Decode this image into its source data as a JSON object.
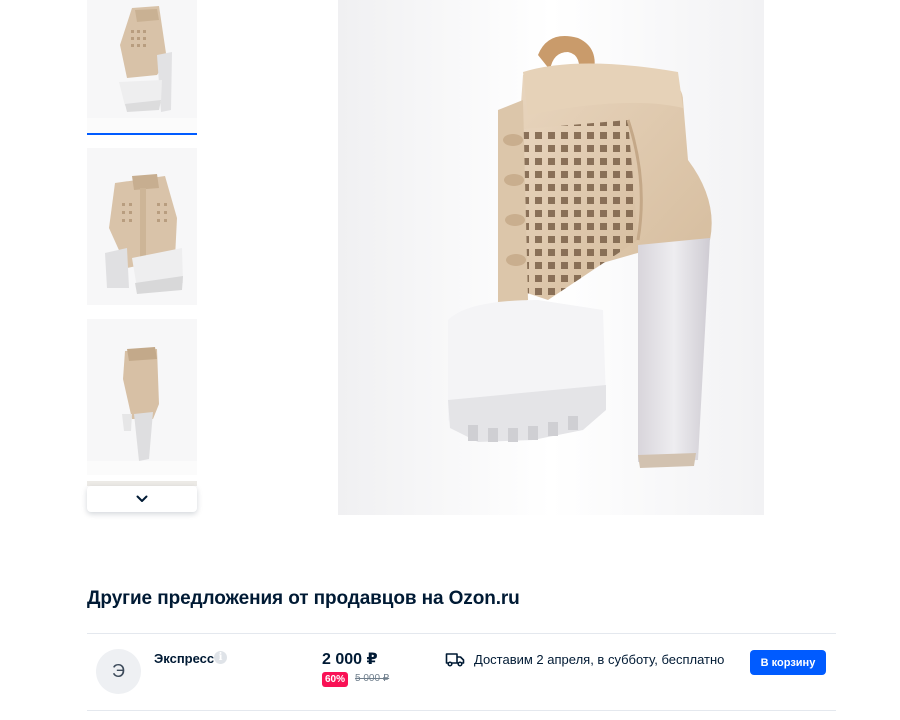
{
  "gallery": {
    "more_icon": "chevron-down-icon",
    "thumbnail_active_color": "#005bff"
  },
  "offers": {
    "title": "Другие предложения от продавцов на Ozon.ru",
    "items": [
      {
        "seller_initial": "Э",
        "seller_name": "Экспресс",
        "info_icon": "i",
        "price": "2 000 ₽",
        "discount": "60%",
        "old_price": "5 000 ₽",
        "delivery_icon": "truck-icon",
        "delivery_text": "Доставим 2 апреля, в субботу, бесплатно",
        "cart_button_label": "В корзину"
      }
    ]
  },
  "colors": {
    "accent": "#005bff",
    "discount": "#f91155",
    "text": "#001a34",
    "muted": "#707f8d"
  }
}
